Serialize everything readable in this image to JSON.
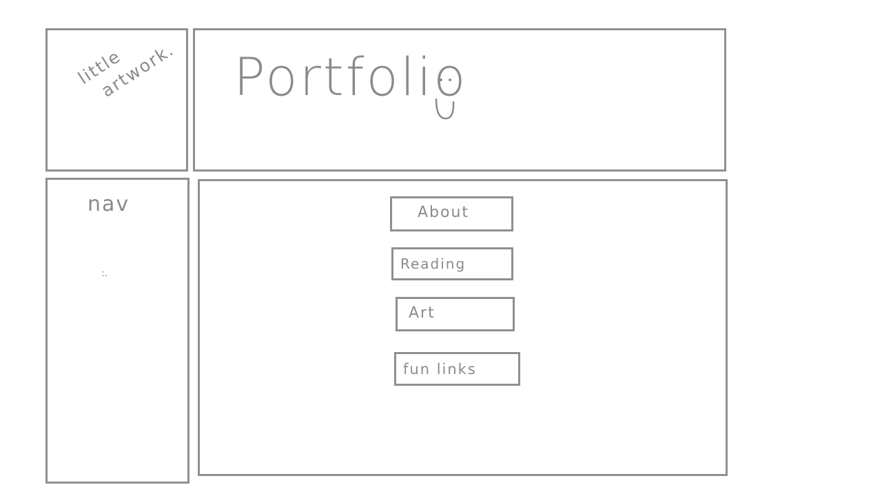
{
  "logo": {
    "line1": "little",
    "line2": "artwork."
  },
  "header": {
    "title": "Portfolio",
    "emoticon": "smiley-icon"
  },
  "nav": {
    "label": "nav",
    "dots": ":."
  },
  "content": {
    "buttons": [
      {
        "label": "About"
      },
      {
        "label": "Reading"
      },
      {
        "label": "Art"
      },
      {
        "label": "fun links"
      }
    ]
  },
  "colors": {
    "stroke": "#8f8f8f",
    "text": "#8a8a8a",
    "background": "#ffffff"
  }
}
